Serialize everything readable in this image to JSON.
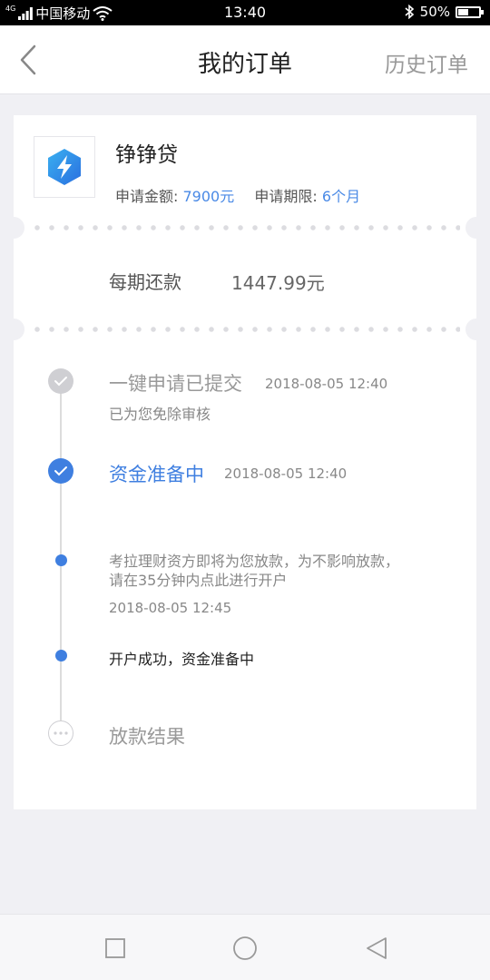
{
  "status_bar": {
    "network": "4G",
    "carrier": "中国移动",
    "time": "13:40",
    "battery": "50%",
    "battery_level": 0.5,
    "icons": [
      "signal-icon",
      "wifi-icon",
      "bluetooth-icon",
      "battery-icon"
    ]
  },
  "header": {
    "title": "我的订单",
    "history_label": "历史订单",
    "back_icon": "chevron-left-icon"
  },
  "order": {
    "product_name": "铮铮贷",
    "logo_icon": "lightning-icon",
    "amount_label": "申请金额:",
    "amount_value": "7900元",
    "term_label": "申请期限:",
    "term_value": "6个月",
    "repay_label": "每期还款",
    "repay_value": "1447.99元"
  },
  "timeline": {
    "steps": [
      {
        "title": "一键申请已提交",
        "time": "2018-08-05 12:40",
        "sub": "已为您免除审核",
        "state": "done"
      },
      {
        "title": "资金准备中",
        "time": "2018-08-05 12:40",
        "state": "current"
      },
      {
        "message_line1": "考拉理财资方即将为您放款，为不影响放款，",
        "message_line2": "请在35分钟内点此进行开户",
        "time": "2018-08-05 12:45",
        "state": "sub"
      },
      {
        "message": "开户成功，资金准备中",
        "state": "sub"
      },
      {
        "title": "放款结果",
        "state": "pending"
      }
    ]
  },
  "colors": {
    "accent": "#3f7fe0",
    "link_blue": "#4a8ae6",
    "grey_node": "#cfcfd3",
    "background": "#f0f0f4"
  },
  "bottom_nav": {
    "icons": [
      "square-icon",
      "circle-icon",
      "triangle-back-icon"
    ]
  }
}
